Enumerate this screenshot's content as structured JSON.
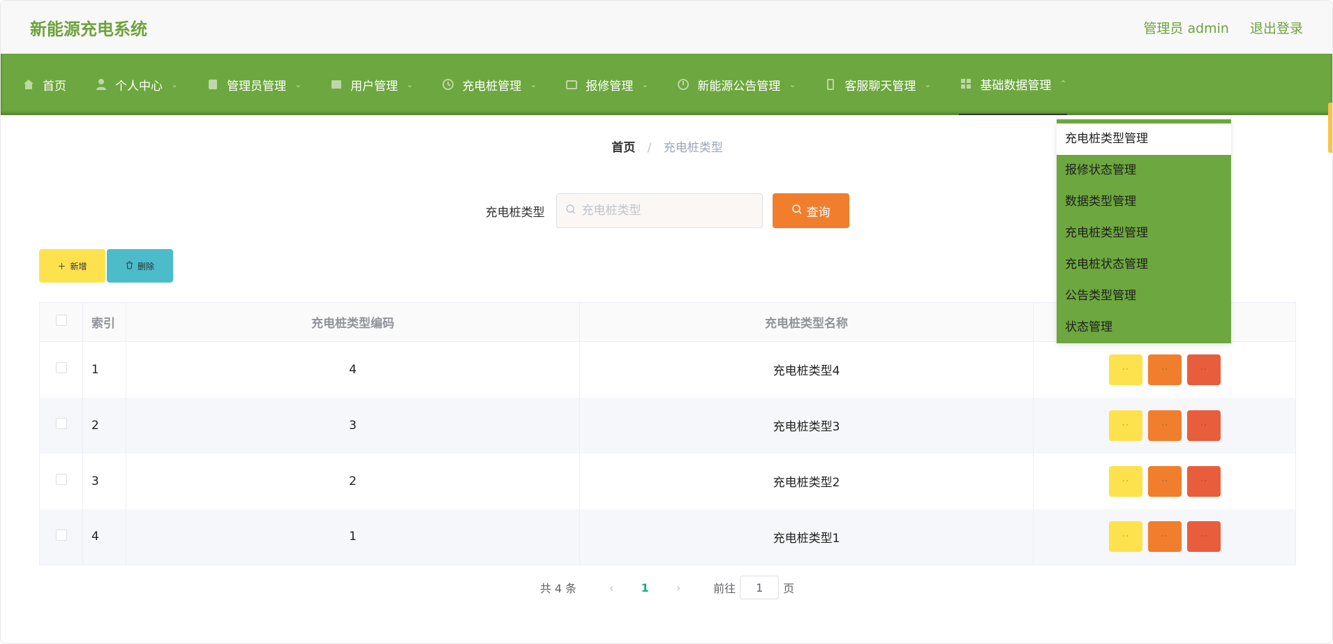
{
  "app": {
    "title": "新能源充电系统"
  },
  "header": {
    "user_label": "管理员 admin",
    "logout": "退出登录"
  },
  "nav": {
    "items": [
      {
        "label": "首页",
        "icon": "home-icon"
      },
      {
        "label": "个人中心",
        "icon": "user-icon"
      },
      {
        "label": "管理员管理",
        "icon": "admin-icon"
      },
      {
        "label": "用户管理",
        "icon": "users-icon"
      },
      {
        "label": "充电桩管理",
        "icon": "charger-icon"
      },
      {
        "label": "报修管理",
        "icon": "repair-icon"
      },
      {
        "label": "新能源公告管理",
        "icon": "notice-icon"
      },
      {
        "label": "客服聊天管理",
        "icon": "chat-icon"
      },
      {
        "label": "基础数据管理",
        "icon": "grid-icon"
      }
    ]
  },
  "dropdown": {
    "items": [
      "充电桩类型管理",
      "报修状态管理",
      "数据类型管理",
      "充电桩类型管理",
      "充电桩状态管理",
      "公告类型管理",
      "状态管理"
    ]
  },
  "breadcrumb": {
    "home": "首页",
    "separator": "/",
    "current": "充电桩类型"
  },
  "search": {
    "label": "充电桩类型",
    "placeholder": "充电桩类型",
    "value": "",
    "button": "查询"
  },
  "actions": {
    "add": "新增",
    "delete": "删除"
  },
  "table": {
    "headers": [
      "索引",
      "充电桩类型编码",
      "充电桩类型名称"
    ],
    "rows": [
      {
        "index": "1",
        "code": "4",
        "name": "充电桩类型4"
      },
      {
        "index": "2",
        "code": "3",
        "name": "充电桩类型3"
      },
      {
        "index": "3",
        "code": "2",
        "name": "充电桩类型2"
      },
      {
        "index": "4",
        "code": "1",
        "name": "充电桩类型1"
      }
    ]
  },
  "pagination": {
    "total": "共 4 条",
    "current": "1",
    "goto_label": "前往",
    "goto_value": "1",
    "page_suffix": "页"
  },
  "colors": {
    "brand": "#6da73f",
    "query": "#f07e2c",
    "add": "#fde24e",
    "delete": "#4cbcca",
    "danger": "#e85d3c"
  }
}
